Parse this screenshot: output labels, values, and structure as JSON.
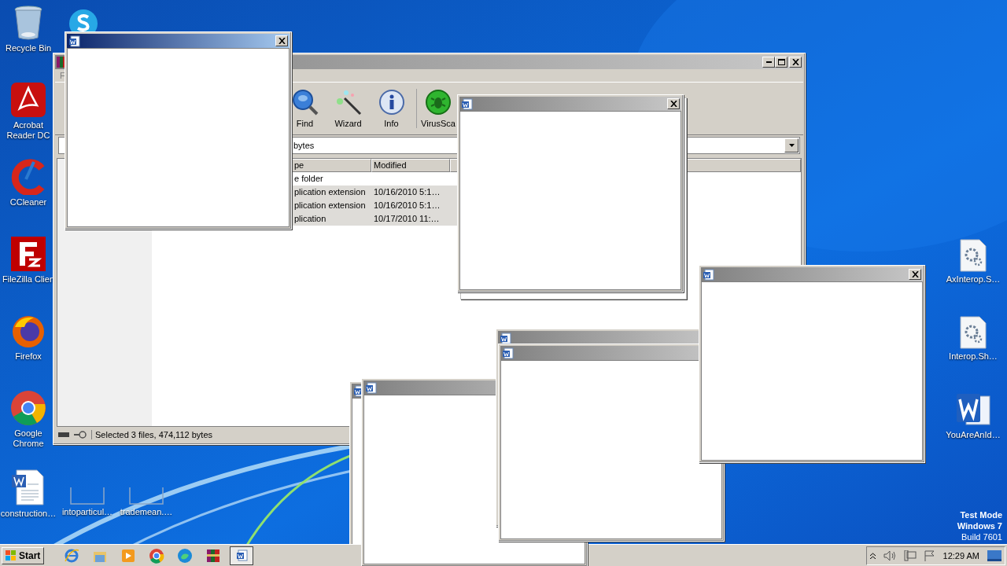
{
  "desktop_icons": [
    {
      "label": "Recycle Bin",
      "kind": "recycle"
    },
    {
      "label": "Acrobat Reader DC",
      "kind": "acrobat"
    },
    {
      "label": "CCleaner",
      "kind": "ccleaner"
    },
    {
      "label": "FileZilla Clien",
      "kind": "filezilla"
    },
    {
      "label": "Firefox",
      "kind": "firefox"
    },
    {
      "label": "Google Chrome",
      "kind": "chrome"
    },
    {
      "label": "construction…",
      "kind": "worddoc"
    },
    {
      "label": "intoparticul…",
      "kind": "blank"
    },
    {
      "label": "trademean.…",
      "kind": "blank"
    },
    {
      "label": "AxInterop.S…",
      "kind": "dll"
    },
    {
      "label": "Interop.Sh…",
      "kind": "dll"
    },
    {
      "label": "YouAreAnId…",
      "kind": "word"
    }
  ],
  "archiver": {
    "menu": [
      "F"
    ],
    "toolbar": [
      {
        "label": "Find",
        "kind": "find"
      },
      {
        "label": "Wizard",
        "kind": "wizard"
      },
      {
        "label": "Info",
        "kind": "info"
      },
      {
        "label": "VirusSca",
        "kind": "virus"
      }
    ],
    "address": "bytes",
    "columns": [
      "pe",
      "Modified"
    ],
    "rows": [
      {
        "type": "e folder",
        "selected": false
      },
      {
        "type": "plication extension",
        "modified": "10/16/2010 5:1…",
        "selected": true
      },
      {
        "type": "plication extension",
        "modified": "10/16/2010 5:1…",
        "selected": true
      },
      {
        "type": "plication",
        "modified": "10/17/2010 11:…",
        "selected": true
      }
    ],
    "status": "Selected 3 files, 474,112 bytes"
  },
  "popups": [
    {
      "kind": "window",
      "active": true
    },
    {
      "kind": "frame"
    },
    {
      "kind": "window",
      "active": false
    },
    {
      "kind": "window",
      "active": false
    },
    {
      "kind": "window",
      "active": false
    },
    {
      "kind": "window",
      "active": false
    },
    {
      "kind": "window",
      "active": false
    },
    {
      "kind": "window",
      "active": false
    }
  ],
  "os_notice": [
    "Test Mode",
    "Windows 7",
    "Build 7601"
  ],
  "taskbar": {
    "start": "Start",
    "apps": [
      {
        "kind": "ie",
        "selected": false
      },
      {
        "kind": "explorer",
        "selected": false
      },
      {
        "kind": "media",
        "selected": false
      },
      {
        "kind": "chrome",
        "selected": false
      },
      {
        "kind": "edge",
        "selected": false
      },
      {
        "kind": "rar",
        "selected": false
      },
      {
        "kind": "word",
        "selected": true
      }
    ],
    "clock": "12:29 AM"
  }
}
